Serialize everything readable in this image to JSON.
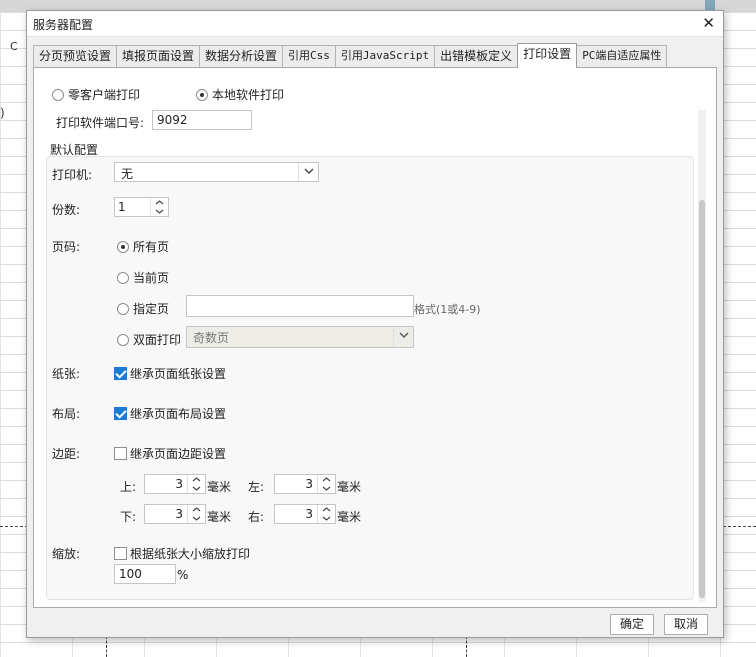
{
  "background": {
    "column_label": "C",
    "paren": ")"
  },
  "dialog": {
    "title": "服务器配置",
    "tabs": [
      {
        "label": "分页预览设置",
        "active": false
      },
      {
        "label": "填报页面设置",
        "active": false
      },
      {
        "label": "数据分析设置",
        "active": false
      },
      {
        "label": "引用Css",
        "active": false
      },
      {
        "label": "引用JavaScript",
        "active": false
      },
      {
        "label": "出错模板定义",
        "active": false
      },
      {
        "label": "打印设置",
        "active": true
      },
      {
        "label": "PC端自适应属性",
        "active": false
      }
    ],
    "print_mode": {
      "zero_client": {
        "label": "零客户端打印",
        "selected": false
      },
      "local_software": {
        "label": "本地软件打印",
        "selected": true
      }
    },
    "port": {
      "label": "打印软件端口号:",
      "value": "9092"
    },
    "defaults_label": "默认配置",
    "printer": {
      "label": "打印机:",
      "value": "无"
    },
    "copies": {
      "label": "份数:",
      "value": "1"
    },
    "page_range": {
      "label": "页码:",
      "all": {
        "label": "所有页",
        "selected": true
      },
      "current": {
        "label": "当前页",
        "selected": false
      },
      "specified": {
        "label": "指定页",
        "selected": false,
        "value": "",
        "hint": "格式(1或4-9)"
      },
      "duplex": {
        "label": "双面打印",
        "selected": false,
        "option": "奇数页"
      }
    },
    "paper": {
      "label": "纸张:",
      "checkbox_label": "继承页面纸张设置",
      "checked": true
    },
    "layout": {
      "label": "布局:",
      "checkbox_label": "继承页面布局设置",
      "checked": true
    },
    "margin": {
      "label": "边距:",
      "checkbox_label": "继承页面边距设置",
      "checked": false,
      "top": {
        "label": "上:",
        "value": "3"
      },
      "left": {
        "label": "左:",
        "value": "3"
      },
      "bottom": {
        "label": "下:",
        "value": "3"
      },
      "right": {
        "label": "右:",
        "value": "3"
      },
      "unit": "毫米"
    },
    "zoom": {
      "label": "缩放:",
      "checkbox_label": "根据纸张大小缩放打印",
      "checked": false,
      "value": "100",
      "unit": "%"
    },
    "buttons": {
      "ok": "确定",
      "cancel": "取消"
    }
  }
}
